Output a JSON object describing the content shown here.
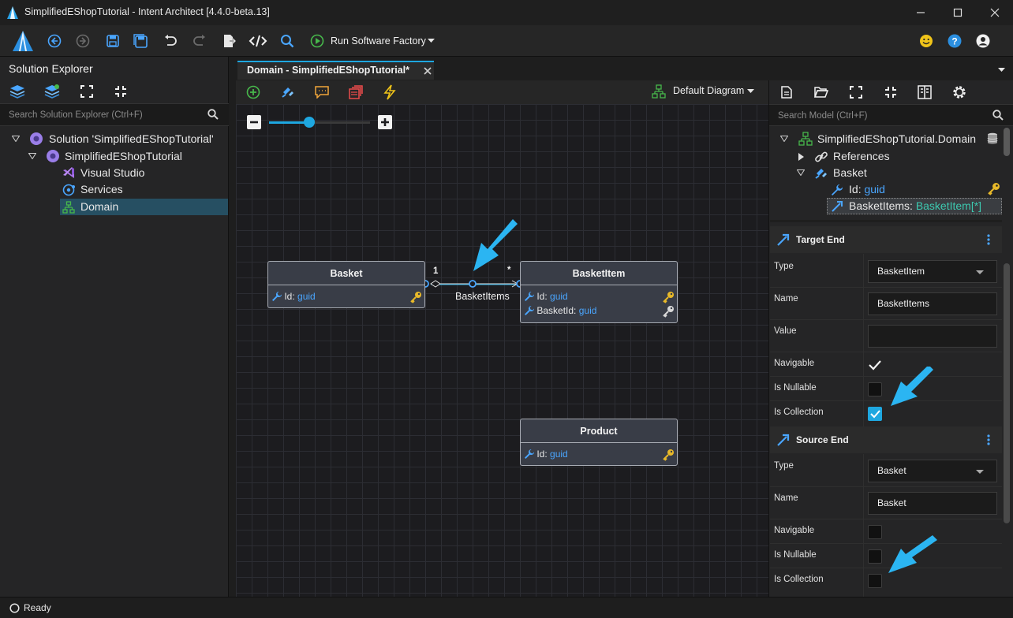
{
  "window": {
    "title": "SimplifiedEShopTutorial - Intent Architect [4.4.0-beta.13]",
    "controls": [
      "minimize-icon",
      "maximize-icon",
      "close-icon"
    ]
  },
  "toolbar": {
    "run_label": "Run Software Factory",
    "icons": [
      "logo-icon",
      "back-icon",
      "forward-icon",
      "save-icon",
      "save-all-icon",
      "undo-icon",
      "redo-icon",
      "export-icon",
      "code-icon",
      "search-icon",
      "play-icon",
      "chevron-down-icon",
      "smiley-icon",
      "help-icon",
      "account-icon"
    ]
  },
  "solution_explorer": {
    "title": "Solution Explorer",
    "search_placeholder": "Search Solution Explorer (Ctrl+F)",
    "tree": [
      {
        "label": "Solution 'SimplifiedEShopTutorial'",
        "level": 0,
        "expanded": true,
        "icon": "solution-icon"
      },
      {
        "label": "SimplifiedEShopTutorial",
        "level": 1,
        "expanded": true,
        "icon": "application-icon"
      },
      {
        "label": "Visual Studio",
        "level": 2,
        "icon": "visual-studio-icon"
      },
      {
        "label": "Services",
        "level": 2,
        "icon": "services-icon"
      },
      {
        "label": "Domain",
        "level": 2,
        "icon": "domain-icon",
        "selected": true
      }
    ]
  },
  "tabs": [
    {
      "label": "Domain - SimplifiedEShopTutorial*",
      "active": true
    }
  ],
  "diagram": {
    "selector_label": "Default Diagram",
    "zoom_level": 0.4,
    "nodes": [
      {
        "name": "Basket",
        "attributes": [
          {
            "name": "Id",
            "sep": ":",
            "type": "guid",
            "key": true
          }
        ]
      },
      {
        "name": "BasketItem",
        "attributes": [
          {
            "name": "Id",
            "sep": ":",
            "type": "guid",
            "key": true
          },
          {
            "name": "BasketId",
            "sep": ":",
            "type": "guid",
            "fk": true
          }
        ]
      },
      {
        "name": "Product",
        "attributes": [
          {
            "name": "Id",
            "sep": ":",
            "type": "guid",
            "key": true
          }
        ]
      }
    ],
    "association": {
      "label": "BasketItems",
      "source_mult": "1",
      "target_mult": "*"
    }
  },
  "model_panel": {
    "search_placeholder": "Search Model (Ctrl+F)",
    "tree": [
      {
        "label": "SimplifiedEShopTutorial.Domain",
        "level": 0
      },
      {
        "label": "References",
        "level": 1
      },
      {
        "label": "Basket",
        "level": 1
      },
      {
        "name": "Id",
        "sep": ": ",
        "type": "guid",
        "level": 2
      },
      {
        "name": "BasketItems",
        "sep": ": ",
        "type": "BasketItem[*]",
        "level": 2,
        "selected": true
      }
    ]
  },
  "properties": {
    "target_end": {
      "title": "Target End",
      "labels": {
        "type": "Type",
        "name": "Name",
        "value": "Value",
        "navigable": "Navigable",
        "nullable": "Is Nullable",
        "collection": "Is Collection"
      },
      "type_value": "BasketItem",
      "name_value": "BasketItems",
      "value_value": "",
      "navigable": true,
      "nullable": false,
      "collection": true
    },
    "source_end": {
      "title": "Source End",
      "labels": {
        "type": "Type",
        "name": "Name",
        "navigable": "Navigable",
        "nullable": "Is Nullable",
        "collection": "Is Collection"
      },
      "type_value": "Basket",
      "name_value": "Basket",
      "navigable": false,
      "nullable": false,
      "collection": false
    }
  },
  "status": {
    "text": "Ready"
  },
  "colors": {
    "accent": "#1ea7e0",
    "type": "#4aa6ff",
    "collection_type": "#3dc9b0",
    "key": "#e8b929"
  }
}
